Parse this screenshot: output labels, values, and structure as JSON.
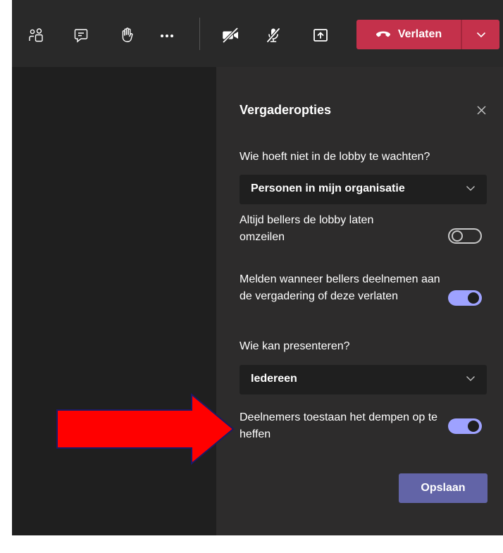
{
  "toolbar": {
    "icons": [
      "participants-icon",
      "chat-icon",
      "raise-hand-icon",
      "more-options-icon",
      "camera-off-icon",
      "mic-off-icon",
      "share-screen-icon"
    ],
    "leave_label": "Verlaten"
  },
  "panel": {
    "title": "Vergaderopties",
    "lobby_question": "Wie hoeft niet in de lobby te wachten?",
    "lobby_value": "Personen in mijn organisatie",
    "bypass_label": "Altijd bellers de lobby laten omzeilen",
    "bypass_enabled": false,
    "announce_label": "Melden wanneer bellers deelnemen aan de vergadering of deze verlaten",
    "announce_enabled": true,
    "presenter_question": "Wie kan presenteren?",
    "presenter_value": "Iedereen",
    "unmute_label": "Deelnemers toestaan het dempen op te heffen",
    "unmute_enabled": true,
    "save_label": "Opslaan"
  },
  "colors": {
    "leave_red": "#c4314b",
    "toggle_on": "#9ea2ff",
    "save_purple": "#6264a7",
    "arrow_red": "#ff0000"
  }
}
